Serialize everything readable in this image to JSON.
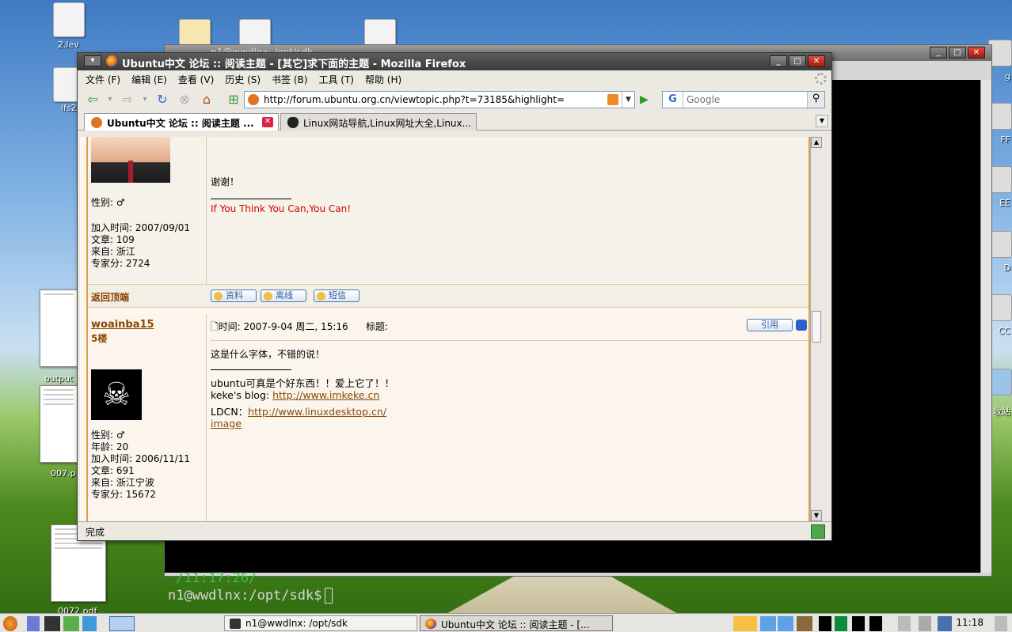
{
  "desktop": {
    "icons": [
      {
        "label": "2.lev"
      },
      {
        "label": "lfs2"
      },
      {
        "label": "output"
      },
      {
        "label": "007.p"
      },
      {
        "label": "0072.pdf"
      }
    ],
    "right_labels": [
      "g",
      "FF",
      "EE",
      "D",
      "CC",
      "收站"
    ]
  },
  "terminal": {
    "title": "n1@wwdlnx: /opt/sdk",
    "line1": "/11:17:26/",
    "prompt": "n1@wwdlnx:/opt/sdk$"
  },
  "firefox": {
    "title": "Ubuntu中文 论坛 :: 阅读主题 - [其它]求下面的主题 - Mozilla Firefox",
    "menu": [
      "文件 (F)",
      "编辑 (E)",
      "查看 (V)",
      "历史 (S)",
      "书签 (B)",
      "工具 (T)",
      "帮助 (H)"
    ],
    "url": "http://forum.ubuntu.org.cn/viewtopic.php?t=73185&highlight=",
    "search_engine": "G",
    "search_placeholder": "Google",
    "tabs": [
      {
        "label": "Ubuntu中文 论坛 :: 阅读主题 ..."
      },
      {
        "label": "Linux网站导航,Linux网址大全,Linux..."
      }
    ],
    "status": "完成"
  },
  "post1": {
    "gender_label": "性别: ♂",
    "join": "加入时间: 2007/09/01",
    "posts": "文章: 109",
    "from": "来自: 浙江",
    "score": "专家分: 2724",
    "body": "谢谢！",
    "signature": "If You Think You Can,You Can!",
    "back_top": "返回顶端",
    "btn_profile": "资料",
    "btn_offline": "离线",
    "btn_pm": "短信"
  },
  "post2": {
    "username": "woainba15",
    "floor": "5楼",
    "gender_label": "性别: ♂",
    "age": "年龄: 20",
    "join": "加入时间: 2006/11/11",
    "posts": "文章: 691",
    "from": "来自: 浙江宁波",
    "score": "专家分: 15672",
    "time": "🗋时间: 2007-9-04 周二, 15:16",
    "subject_label": "标题:",
    "quote_btn": "引用",
    "body": "这是什么字体，不错的说！",
    "sig_line1": "ubuntu可真是个好东西！！爱上它了！！",
    "blog_label": "keke's blog: ",
    "blog_link": "http://www.imkeke.cn",
    "ldcn_label": "LDCN：",
    "ldcn_link": "http://www.linuxdesktop.cn/",
    "image_link": "image"
  },
  "taskbar": {
    "window1": "n1@wwdlnx: /opt/sdk",
    "window2": "Ubuntu中文 论坛 :: 阅读主题 - [...",
    "clock": "11:18"
  },
  "colors": {
    "accent": "#e39f4a",
    "signature_red": "#d40000",
    "link_brown": "#8a4a00"
  }
}
